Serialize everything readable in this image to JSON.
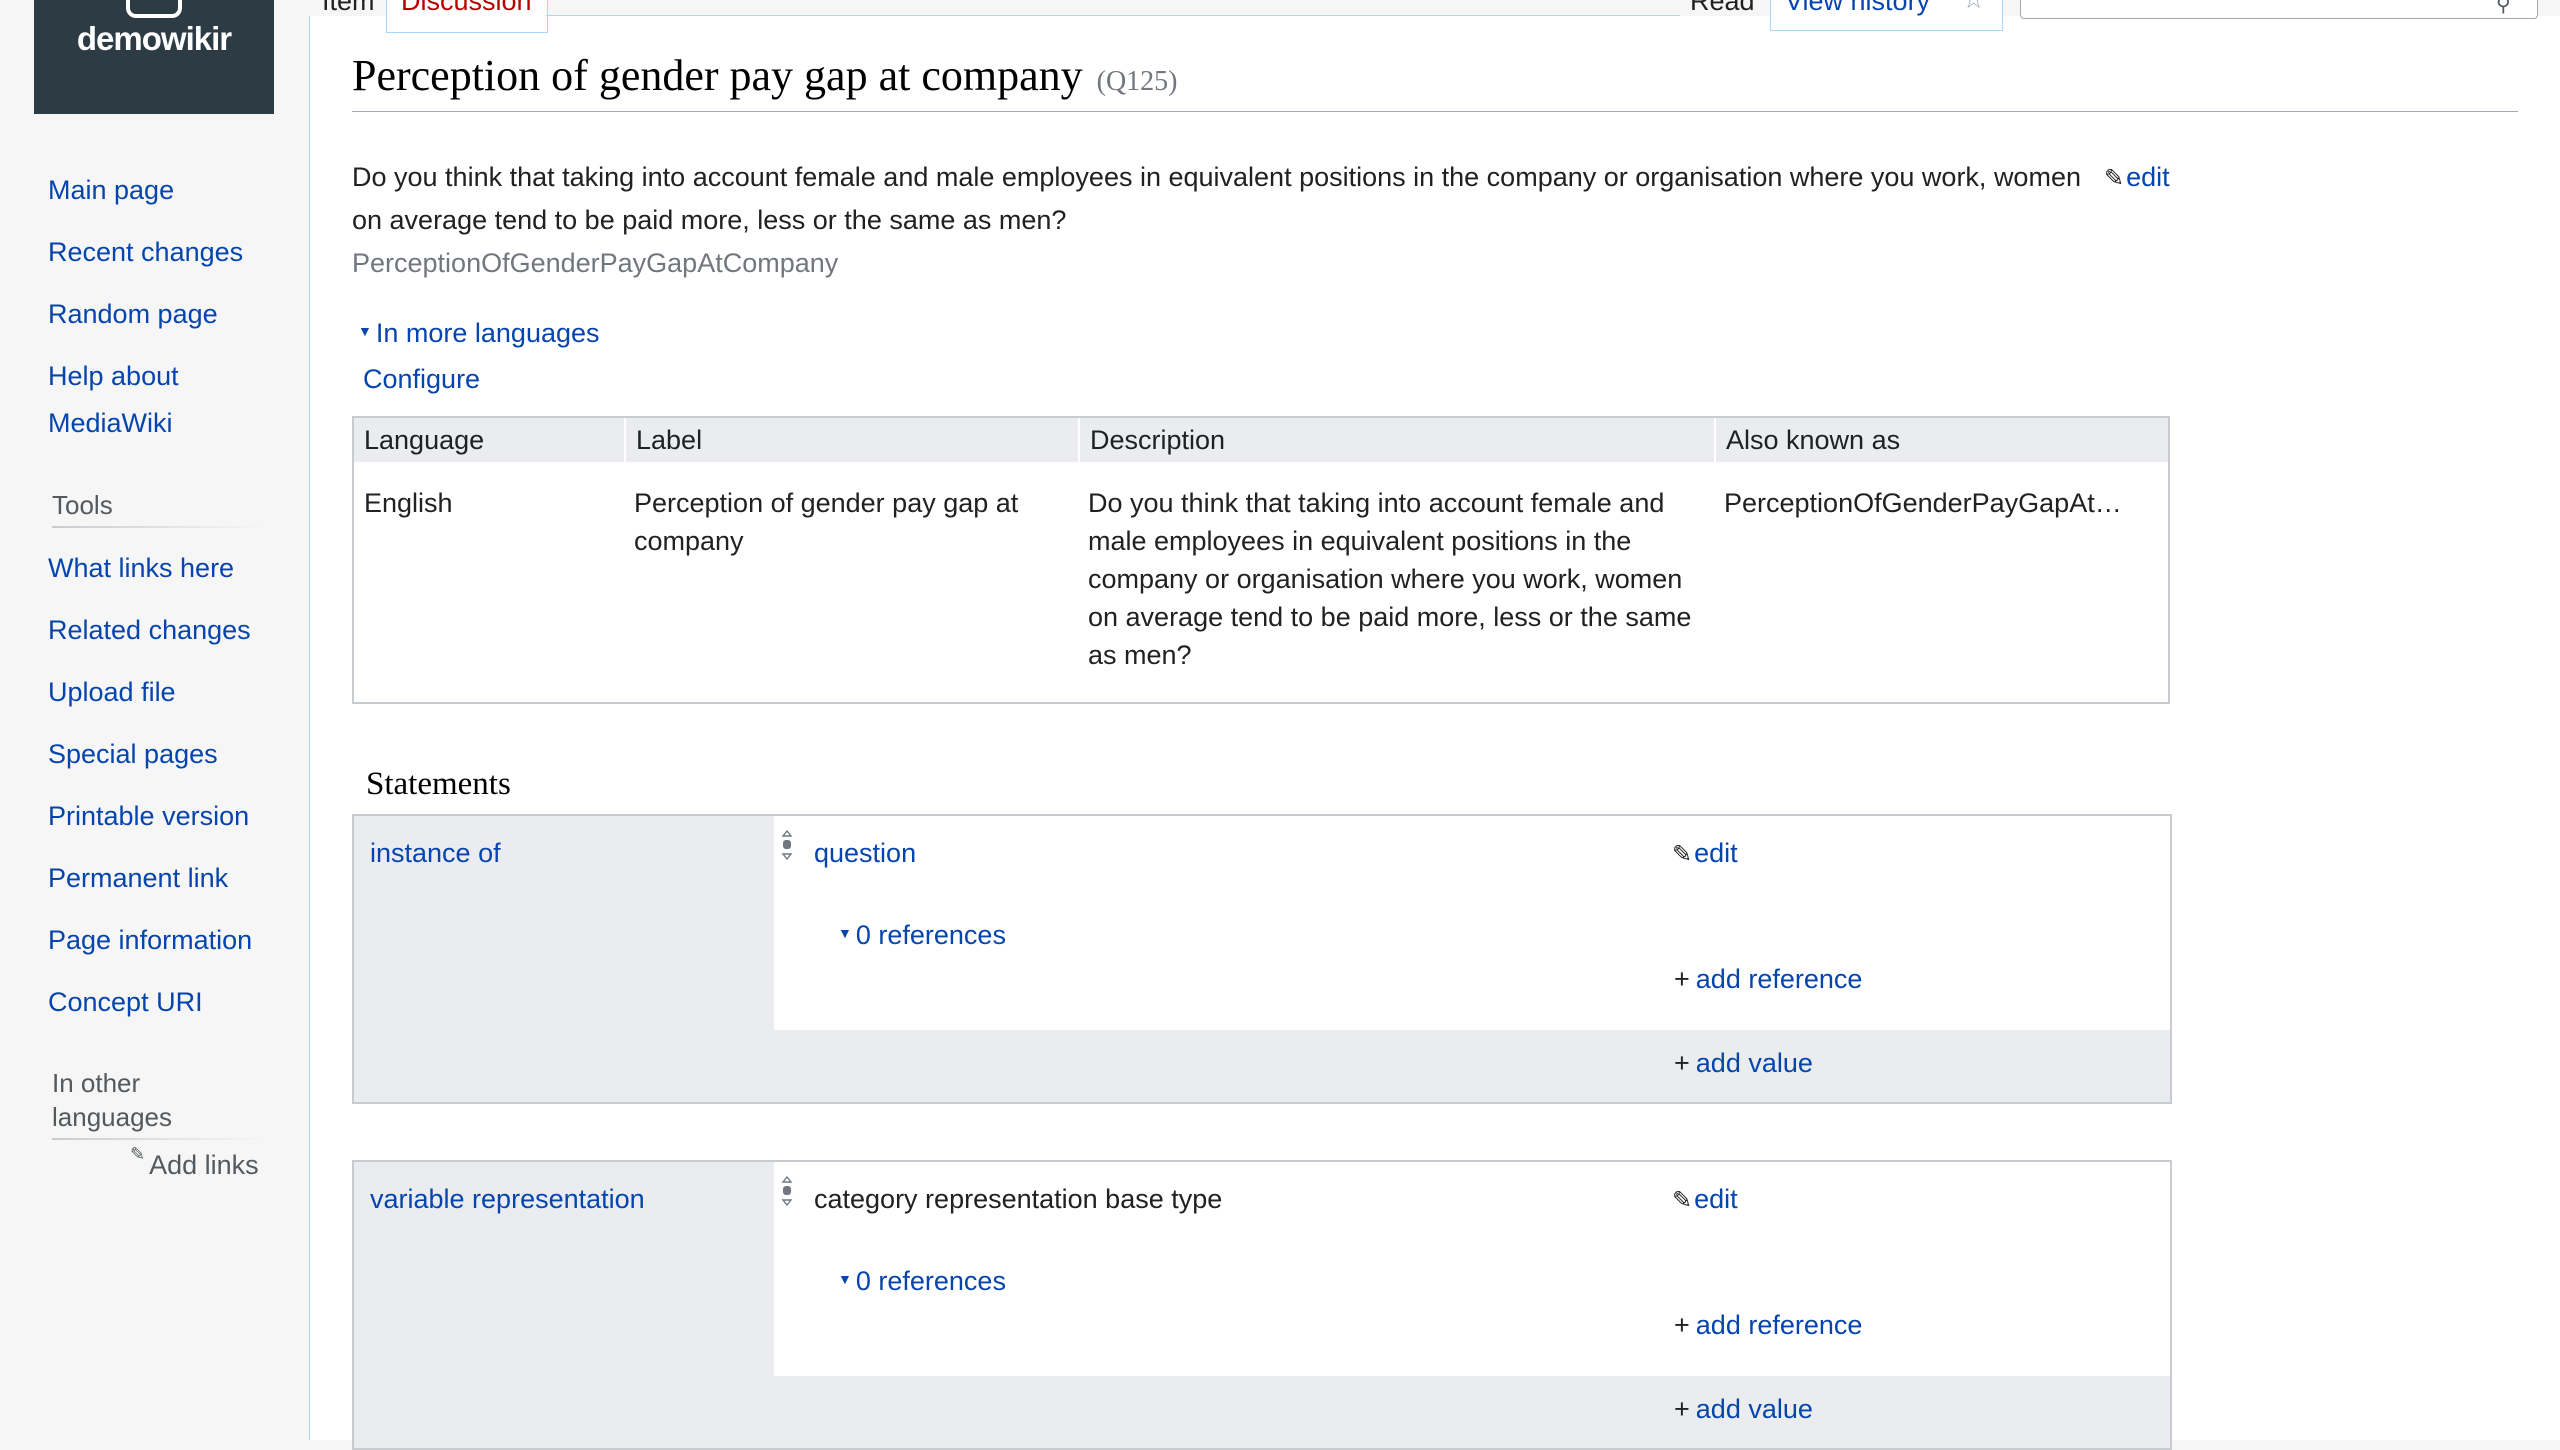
{
  "logo": {
    "text": "demowikir"
  },
  "sidebar": {
    "nav": [
      "Main page",
      "Recent changes",
      "Random page",
      "Help about",
      "MediaWiki"
    ],
    "tools_heading": "Tools",
    "tools": [
      "What links here",
      "Related changes",
      "Upload file",
      "Special pages",
      "Printable version",
      "Permanent link",
      "Page information",
      "Concept URI"
    ],
    "languages_heading_line1": "In other",
    "languages_heading_line2": "languages",
    "add_links": "Add links"
  },
  "tabs": {
    "item": "Item",
    "discussion": "Discussion",
    "read": "Read",
    "history": "View history",
    "watch": "☆"
  },
  "page": {
    "title": "Perception of gender pay gap at company",
    "qid": "(Q125)",
    "description": "Do you think that taking into account female and male employees in equivalent positions in the company or organisation where you work, women on average tend to be paid more, less or the same as men?",
    "description_edit": "edit",
    "aliases": "PerceptionOfGenderPayGapAtCompany",
    "more_languages": "In more languages",
    "configure": "Configure"
  },
  "languages_table": {
    "headers": [
      "Language",
      "Label",
      "Description",
      "Also known as"
    ],
    "row": {
      "language": "English",
      "label": "Perception of gender pay gap at company",
      "description": "Do you think that taking into account female and male employees in equivalent positions in the company or organisation where you work, women on average tend to be paid more, less or the same as men?",
      "aliases": "PerceptionOfGenderPayGapAt…"
    }
  },
  "statements": {
    "heading": "Statements",
    "items": [
      {
        "property": "instance of",
        "value": "question",
        "edit": "edit",
        "references": "0 references",
        "add_reference": "add reference",
        "add_value": "add value"
      },
      {
        "property": "variable representation",
        "value": "category representation base type",
        "edit": "edit",
        "references": "0 references",
        "add_reference": "add reference",
        "add_value": "add value"
      }
    ]
  },
  "colors": {
    "link": "#0645ad",
    "new_link": "#ba0000",
    "sidebar_bg": "#f6f6f6",
    "logo_bg": "#2d3b45",
    "table_header_bg": "#eaecf0"
  }
}
